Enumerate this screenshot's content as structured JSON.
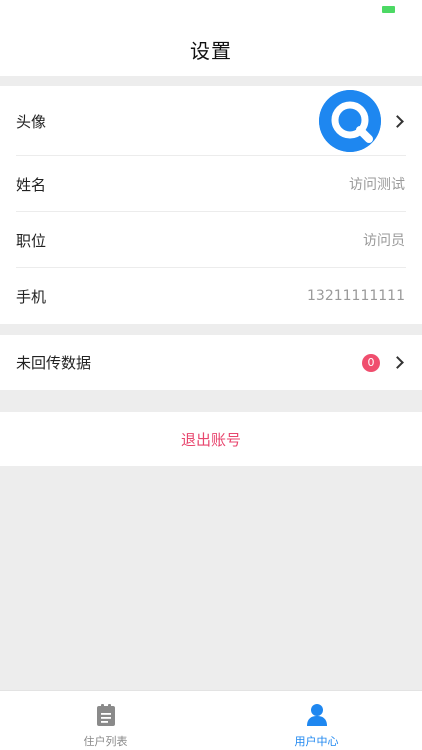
{
  "colors": {
    "accent": "#1e87f0",
    "danger": "#e8466e",
    "badge": "#f04e6e",
    "battery": "#4cd964"
  },
  "header": {
    "title": "设置"
  },
  "profile": {
    "avatar_label": "头像",
    "avatar_icon": "search-logo-icon",
    "rows": [
      {
        "label": "姓名",
        "value": "访问测试"
      },
      {
        "label": "职位",
        "value": "访问员"
      },
      {
        "label": "手机",
        "value": "13211111111"
      }
    ]
  },
  "unsynced": {
    "label": "未回传数据",
    "count": "0"
  },
  "logout": {
    "label": "退出账号"
  },
  "tabs": [
    {
      "label": "住户列表",
      "icon": "clipboard-icon",
      "active": false
    },
    {
      "label": "用户中心",
      "icon": "user-icon",
      "active": true
    }
  ]
}
